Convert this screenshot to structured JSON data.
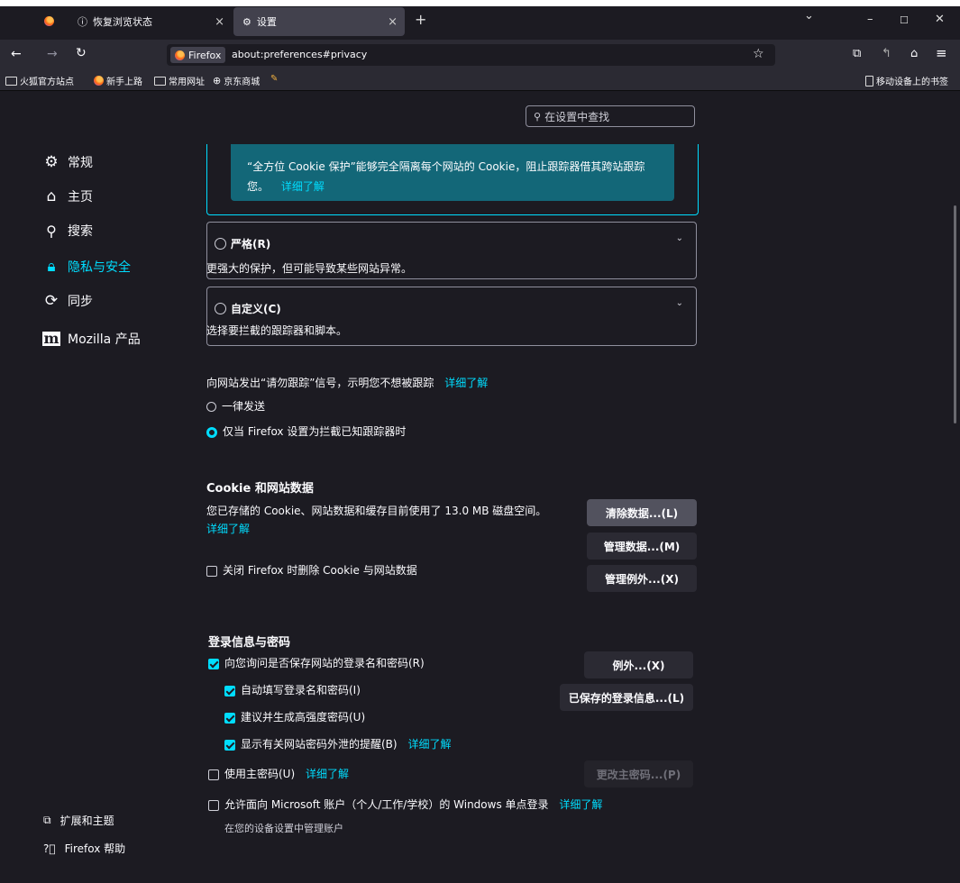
{
  "tabs": [
    {
      "label": "恢复浏览状态"
    },
    {
      "label": "设置"
    }
  ],
  "window_controls": {
    "list": "⌄",
    "minimize": "–",
    "maximize": "☐",
    "close": "✕"
  },
  "navbar": {
    "identity_badge": "Firefox",
    "url": "about:preferences#privacy"
  },
  "bookmarks": {
    "items": [
      {
        "label": "火狐官方站点"
      },
      {
        "label": "新手上路"
      },
      {
        "label": "常用网址"
      },
      {
        "label": "京东商城"
      }
    ],
    "mobile": "移动设备上的书签"
  },
  "search": {
    "placeholder": "在设置中查找"
  },
  "sidebar": {
    "items": [
      {
        "label": "常规"
      },
      {
        "label": "主页"
      },
      {
        "label": "搜索"
      },
      {
        "label": "隐私与安全"
      },
      {
        "label": "同步"
      },
      {
        "label": "Mozilla 产品"
      }
    ],
    "footer": [
      {
        "label": "扩展和主题"
      },
      {
        "label": "Firefox 帮助"
      }
    ]
  },
  "tracking": {
    "standard_info_line1": "“全方位 Cookie 保护”能够完全隔离每个网站的 Cookie，阻止跟踪器借其跨站跟踪",
    "standard_info_line2": "您。",
    "learn_more": "详细了解",
    "strict": {
      "title": "严格(R)",
      "desc": "更强大的保护，但可能导致某些网站异常。"
    },
    "custom": {
      "title": "自定义(C)",
      "desc": "选择要拦截的跟踪器和脚本。"
    }
  },
  "dnt": {
    "label": "向网站发出“请勿跟踪”信号，示明您不想被跟踪",
    "learn_more": "详细了解",
    "opt_always": "一律发送",
    "opt_when_blocking": "仅当 Firefox 设置为拦截已知跟踪器时"
  },
  "cookies": {
    "heading": "Cookie 和网站数据",
    "usage": "您已存储的 Cookie、网站数据和缓存目前使用了 13.0 MB 磁盘空间。",
    "learn_more": "详细了解",
    "clear_btn": "清除数据...(L)",
    "manage_btn": "管理数据...(M)",
    "exceptions_btn": "管理例外...(X)",
    "delete_on_close": "关闭 Firefox 时删除 Cookie 与网站数据"
  },
  "logins": {
    "heading": "登录信息与密码",
    "ask_save": "向您询问是否保存网站的登录名和密码(R)",
    "autofill": "自动填写登录名和密码(I)",
    "suggest": "建议并生成高强度密码(U)",
    "breach": "显示有关网站密码外泄的提醒(B)",
    "breach_learn_more": "详细了解",
    "primary_pw": "使用主密码(U)",
    "primary_learn_more": "详细了解",
    "sso": "允许面向 Microsoft 账户（个人/工作/学校）的 Windows 单点登录",
    "sso_learn_more": "详细了解",
    "sso_note": "在您的设备设置中管理账户",
    "exceptions_btn": "例外...(X)",
    "saved_btn": "已保存的登录信息...(L)",
    "change_pw_btn": "更改主密码...(P)"
  }
}
